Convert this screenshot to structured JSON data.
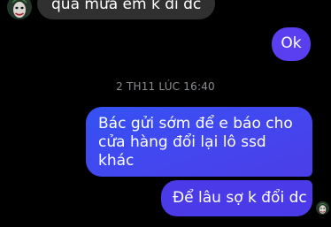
{
  "chat": {
    "incoming_message": "quả mưa em k đi dc",
    "outgoing_ok": "Ok",
    "timestamp": "2 TH11 LÚC 16:40",
    "outgoing_long": {
      "line1": "Bác gửi sớm để e báo cho",
      "line2": "cửa hàng đổi lại lô ssd",
      "line3": "khác"
    },
    "outgoing_last": "Để lâu sợ k đổi dc"
  },
  "icons": {
    "contact_avatar": "joker-avatar",
    "read_receipt": "joker-avatar-small"
  },
  "colors": {
    "background": "#000000",
    "incoming_bubble": "#303030",
    "outgoing_bubble": "#4b3ee8",
    "timestamp_text": "#8a8d92"
  }
}
